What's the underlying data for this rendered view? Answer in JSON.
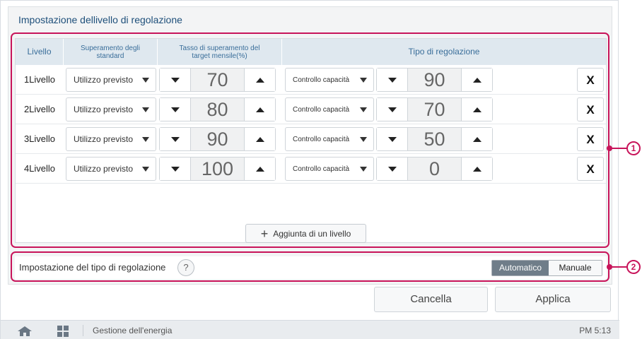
{
  "page": {
    "title": "Impostazione dellivello di regolazione"
  },
  "table": {
    "headers": {
      "level": "Livello",
      "exceed_standard": "Superamento degli standard",
      "monthly_target": "Tasso di superamento del target mensile(%)",
      "regulation_type": "Tipo di regolazione"
    },
    "rows": [
      {
        "level": "1Livello",
        "usage": "Utilizzo previsto",
        "target": "70",
        "control": "Controllo capacità",
        "control_value": "90",
        "delete": "X"
      },
      {
        "level": "2Livello",
        "usage": "Utilizzo previsto",
        "target": "80",
        "control": "Controllo capacità",
        "control_value": "70",
        "delete": "X"
      },
      {
        "level": "3Livello",
        "usage": "Utilizzo previsto",
        "target": "90",
        "control": "Controllo capacità",
        "control_value": "50",
        "delete": "X"
      },
      {
        "level": "4Livello",
        "usage": "Utilizzo previsto",
        "target": "100",
        "control": "Controllo capacità",
        "control_value": "0",
        "delete": "X"
      }
    ],
    "add_button": "Aggiunta di un livello"
  },
  "regulation_mode": {
    "label": "Impostazione del tipo di regolazione",
    "help": "?",
    "options": [
      "Automatico",
      "Manuale"
    ],
    "selected": "Automatico"
  },
  "actions": {
    "cancel": "Cancella",
    "apply": "Applica"
  },
  "callouts": [
    "1",
    "2"
  ],
  "footer": {
    "app_name": "Gestione dell'energia",
    "time": "PM 5:13"
  },
  "icons": {
    "home": "home-icon",
    "grid": "grid-icon",
    "help": "help-icon",
    "add": "plus-icon"
  },
  "colors": {
    "accent_title": "#1e4f7a",
    "header_bg": "#dfe8ef",
    "header_text": "#3a6e9a",
    "highlight": "#c8145a",
    "toggle_active": "#6f7d89"
  }
}
